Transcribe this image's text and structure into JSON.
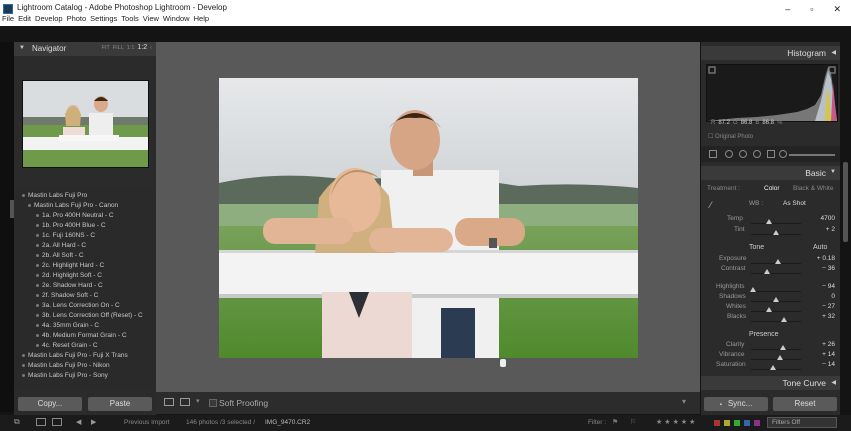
{
  "window": {
    "title": "Lightroom Catalog - Adobe Photoshop Lightroom - Develop",
    "menu": [
      "File",
      "Edit",
      "Develop",
      "Photo",
      "Settings",
      "Tools",
      "View",
      "Window",
      "Help"
    ],
    "controls": {
      "minimize": "–",
      "maximize": "▫",
      "close": "✕"
    }
  },
  "navigator": {
    "title": "Navigator",
    "zoom_options": [
      "FIT",
      "FILL",
      "1:1",
      "1:2"
    ],
    "zoom_selected": "1:2"
  },
  "presets": [
    "Mastin Labs Fuji Pro",
    "Mastin Labs Fuji Pro - Canon",
    "1a. Pro 400H Neutral - C",
    "1b. Pro 400H Blue - C",
    "1c. Fuji 160NS - C",
    "2a. All Hard - C",
    "2b. All Soft - C",
    "2c. Highlight Hard - C",
    "2d. Highlight Soft - C",
    "2e. Shadow Hard - C",
    "2f. Shadow Soft - C",
    "3a. Lens Correction On - C",
    "3b. Lens Correction Off (Reset) - C",
    "4a. 35mm Grain - C",
    "4b. Medium Format Grain - C",
    "4c. Reset Grain - C",
    "Mastin Labs Fuji Pro - Fuji X Trans",
    "Mastin Labs Fuji Pro - Nikon",
    "Mastin Labs Fuji Pro - Sony"
  ],
  "left_buttons": {
    "copy": "Copy...",
    "paste": "Paste"
  },
  "toolbar": {
    "soft_proofing": "Soft Proofing"
  },
  "histogram": {
    "title": "Histogram",
    "r_label": "R",
    "r_value": "87.2",
    "g_label": "G",
    "g_value": "86.8",
    "b_label": "B",
    "b_value": "86.8",
    "unit": "%",
    "original_photo": "Original Photo"
  },
  "basic": {
    "title": "Basic",
    "treatment_label": "Treatment :",
    "color_tab": "Color",
    "bw_tab": "Black & White",
    "wb_label": "WB :",
    "wb_value": "As Shot",
    "tone_label": "Tone",
    "tone_auto": "Auto",
    "presence_label": "Presence",
    "sliders": [
      {
        "label": "Temp",
        "value": "4700",
        "pos": 0.35
      },
      {
        "label": "Tint",
        "value": "+ 2",
        "pos": 0.5
      },
      {
        "label": "Exposure",
        "value": "+ 0.18",
        "pos": 0.53
      },
      {
        "label": "Contrast",
        "value": "− 36",
        "pos": 0.32
      },
      {
        "label": "Highlights",
        "value": "− 94",
        "pos": 0.03
      },
      {
        "label": "Shadows",
        "value": "0",
        "pos": 0.5
      },
      {
        "label": "Whites",
        "value": "− 27",
        "pos": 0.36
      },
      {
        "label": "Blacks",
        "value": "+ 32",
        "pos": 0.66
      },
      {
        "label": "Clarity",
        "value": "+ 26",
        "pos": 0.63
      },
      {
        "label": "Vibrance",
        "value": "+ 14",
        "pos": 0.57
      },
      {
        "label": "Saturation",
        "value": "− 14",
        "pos": 0.43
      }
    ]
  },
  "tone_curve": {
    "title": "Tone Curve"
  },
  "right_buttons": {
    "sync": "Sync...",
    "reset": "Reset"
  },
  "filmstrip": {
    "previous_import": "Previous Import",
    "photo_info": "146 photos /3 selected /",
    "filename": "IMG_9470.CR2",
    "filter_label": "Filter :",
    "filter_value": "Filters Off"
  },
  "colors": {
    "panel": "#2b2b2b",
    "header": "#3a3a3a",
    "center": "#595959"
  }
}
